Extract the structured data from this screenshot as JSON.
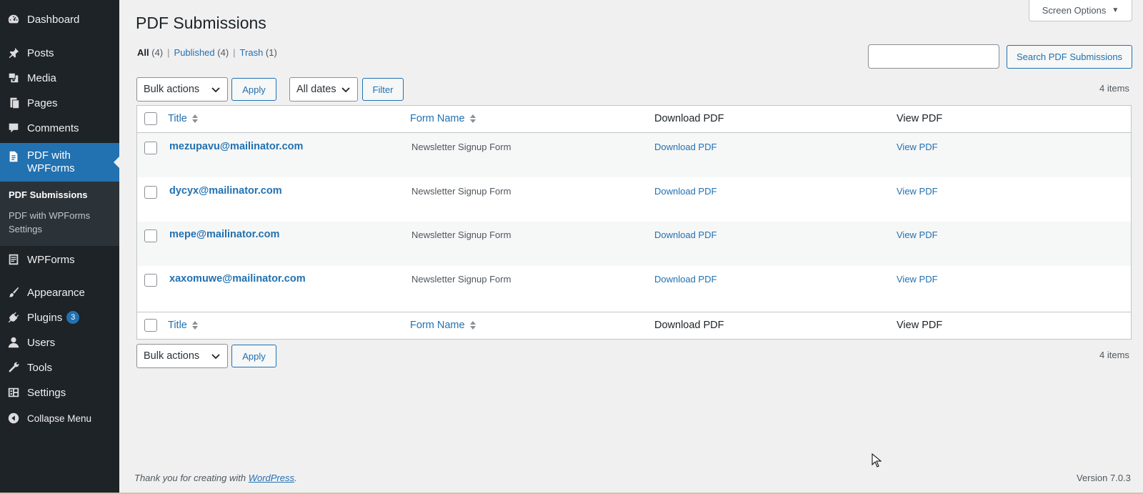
{
  "sidebar": {
    "items": [
      {
        "label": "Dashboard",
        "icon": "dashboard-icon"
      },
      {
        "label": "Posts",
        "icon": "pin-icon"
      },
      {
        "label": "Media",
        "icon": "media-icon"
      },
      {
        "label": "Pages",
        "icon": "pages-icon"
      },
      {
        "label": "Comments",
        "icon": "comment-icon"
      },
      {
        "label": "PDF with WPForms",
        "icon": "document-icon",
        "active": true
      },
      {
        "label": "WPForms",
        "icon": "forms-icon"
      },
      {
        "label": "Appearance",
        "icon": "brush-icon"
      },
      {
        "label": "Plugins",
        "icon": "plugin-icon",
        "badge": "3"
      },
      {
        "label": "Users",
        "icon": "user-icon"
      },
      {
        "label": "Tools",
        "icon": "wrench-icon"
      },
      {
        "label": "Settings",
        "icon": "settings-icon"
      },
      {
        "label": "Collapse Menu",
        "icon": "collapse-icon"
      }
    ],
    "submenu": [
      {
        "label": "PDF Submissions",
        "current": true
      },
      {
        "label": "PDF with WPForms Settings"
      }
    ],
    "active_color": "#2271b1"
  },
  "screen_options": {
    "label": "Screen Options"
  },
  "page_title": "PDF Submissions",
  "views": {
    "all": {
      "label": "All",
      "count": "(4)"
    },
    "published": {
      "label": "Published",
      "count": "(4)"
    },
    "trash": {
      "label": "Trash",
      "count": "(1)"
    }
  },
  "search": {
    "button_label": "Search PDF Submissions",
    "value": ""
  },
  "top_nav": {
    "bulk_actions": "Bulk actions",
    "apply": "Apply",
    "dates": "All dates",
    "filter": "Filter",
    "items_count": "4 items"
  },
  "bottom_nav": {
    "bulk_actions": "Bulk actions",
    "apply": "Apply",
    "items_count": "4 items"
  },
  "table": {
    "columns": [
      "Title",
      "Form Name",
      "Download PDF",
      "View PDF"
    ],
    "rows": [
      {
        "title": "mezupavu@mailinator.com",
        "form": "Newsletter Signup Form",
        "download": "Download PDF",
        "view": "View PDF"
      },
      {
        "title": "dycyx@mailinator.com",
        "form": "Newsletter Signup Form",
        "download": "Download PDF",
        "view": "View PDF"
      },
      {
        "title": "mepe@mailinator.com",
        "form": "Newsletter Signup Form",
        "download": "Download PDF",
        "view": "View PDF"
      },
      {
        "title": "xaxomuwe@mailinator.com",
        "form": "Newsletter Signup Form",
        "download": "Download PDF",
        "view": "View PDF"
      }
    ]
  },
  "footer": {
    "thanks_prefix": "Thank you for creating with ",
    "thanks_link": "WordPress",
    "thanks_suffix": ".",
    "version": "Version 7.0.3"
  }
}
